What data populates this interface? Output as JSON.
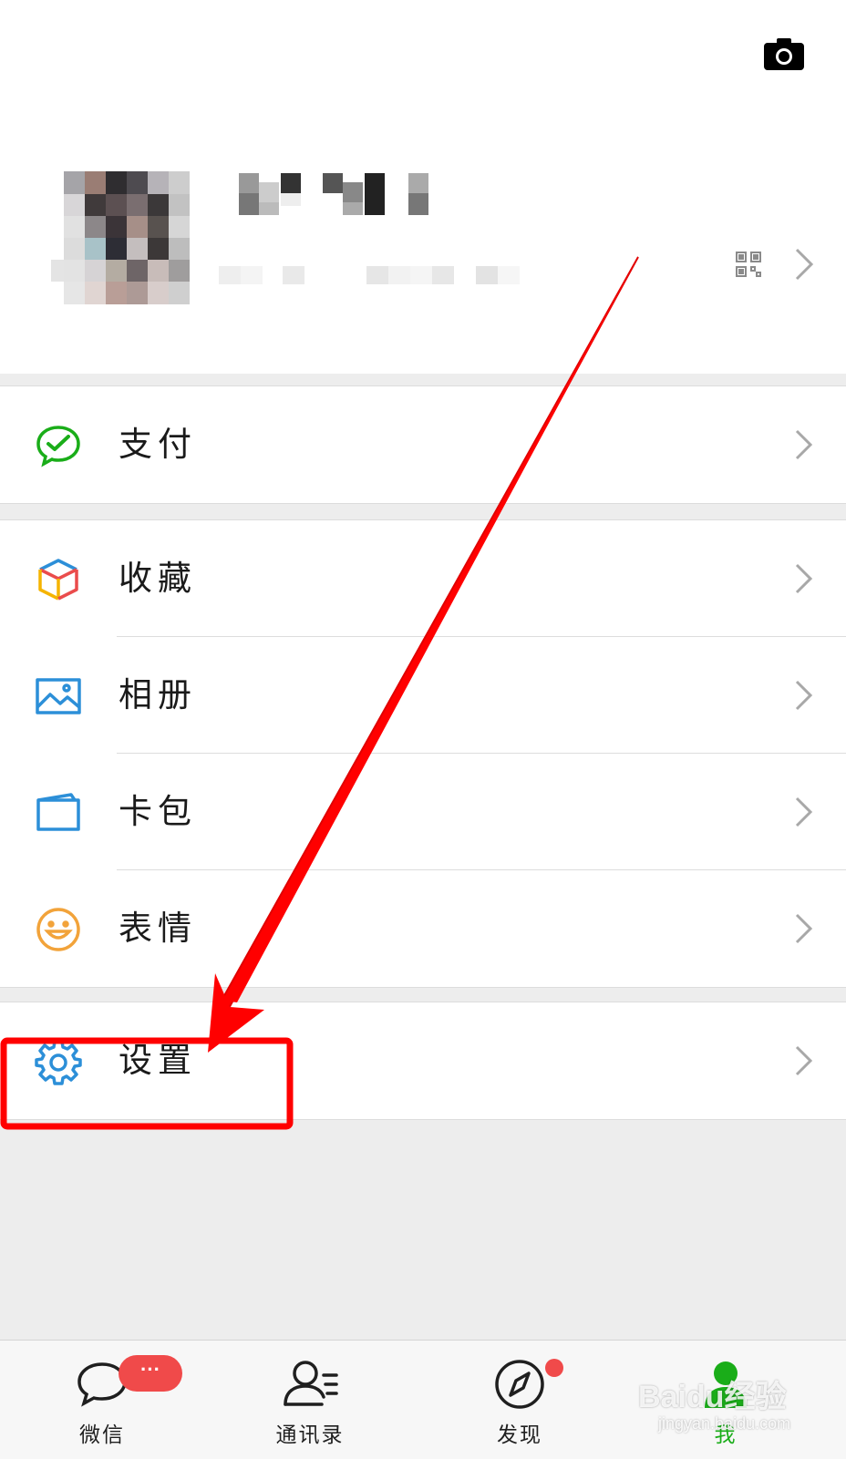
{
  "profile": {
    "name": "",
    "wechat_id": "",
    "qr_icon": "qr-code-icon",
    "camera_icon": "camera-icon"
  },
  "menu": {
    "pay": {
      "label": "支付",
      "icon": "wechat-pay-icon",
      "color": "#1aad19"
    },
    "favorites": {
      "label": "收藏",
      "icon": "cube-icon"
    },
    "album": {
      "label": "相册",
      "icon": "picture-icon",
      "color": "#2c8fd8"
    },
    "cards": {
      "label": "卡包",
      "icon": "card-wallet-icon",
      "color": "#2c8fd8"
    },
    "stickers": {
      "label": "表情",
      "icon": "smiley-icon",
      "color": "#f2a33a"
    },
    "settings": {
      "label": "设置",
      "icon": "gear-icon",
      "color": "#2c8fd8"
    }
  },
  "tabbar": {
    "tabs": [
      {
        "label": "微信",
        "icon": "chat-bubble-icon",
        "badge": "···"
      },
      {
        "label": "通讯录",
        "icon": "contacts-icon"
      },
      {
        "label": "发现",
        "icon": "compass-icon"
      },
      {
        "label": "我",
        "icon": "person-icon",
        "active": true
      }
    ],
    "active_color": "#1aad19"
  },
  "annotation": {
    "color": "#ff0000"
  },
  "watermark": {
    "text": "Baidu经验",
    "sub": "jingyan.baidu.com"
  }
}
